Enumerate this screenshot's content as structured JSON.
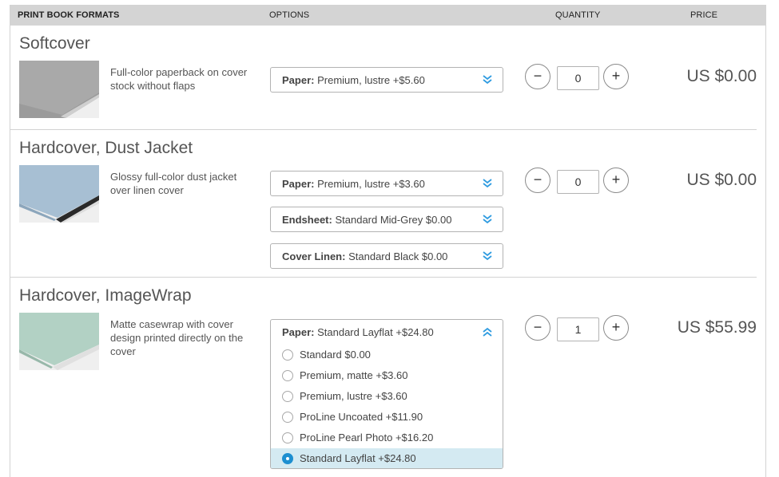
{
  "header": {
    "formats": "PRINT BOOK FORMATS",
    "options": "OPTIONS",
    "quantity": "QUANTITY",
    "price": "PRICE"
  },
  "softcover": {
    "title": "Softcover",
    "description": "Full-color paperback on cover stock without flaps",
    "paper": {
      "label": "Paper:",
      "value": "Premium, lustre +$5.60"
    },
    "quantity": "0",
    "price": "US $0.00"
  },
  "dust_jacket": {
    "title": "Hardcover, Dust Jacket",
    "description": "Glossy full-color dust jacket over linen cover",
    "paper": {
      "label": "Paper:",
      "value": "Premium, lustre +$3.60"
    },
    "endsheet": {
      "label": "Endsheet:",
      "value": "Standard Mid-Grey $0.00"
    },
    "cover_linen": {
      "label": "Cover Linen:",
      "value": "Standard Black $0.00"
    },
    "quantity": "0",
    "price": "US $0.00"
  },
  "imagewrap": {
    "title": "Hardcover, ImageWrap",
    "description": "Matte casewrap with cover design printed directly on the cover",
    "paper": {
      "label": "Paper:",
      "value": "Standard Layflat +$24.80",
      "options": [
        "Standard $0.00",
        "Premium, matte +$3.60",
        "Premium, lustre +$3.60",
        "ProLine Uncoated +$11.90",
        "ProLine Pearl Photo +$16.20",
        "Standard Layflat +$24.80"
      ],
      "selected_index": 5
    },
    "quantity": "1",
    "price": "US $55.99"
  },
  "colors": {
    "accent": "#1e8fd0",
    "header_bg": "#d4d4d4",
    "selected_bg": "#d4eaf2"
  },
  "quantity_controls": {
    "minus": "−",
    "plus": "+"
  }
}
